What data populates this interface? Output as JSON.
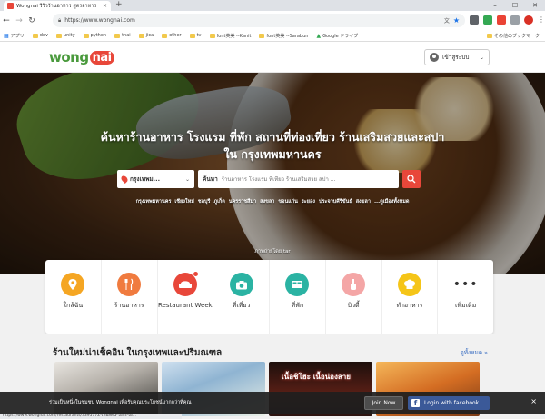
{
  "browser": {
    "tab_title": "Wongnai รีวิวร้านอาหาร สูตรอาหาร",
    "tab_close": "×",
    "new_tab": "+",
    "url": "https://www.wongnai.com",
    "bookmarks": [
      "アプリ",
      "dev",
      "unity",
      "python",
      "thai",
      "jica",
      "other",
      "tv",
      "font英美 --Kanit",
      "font英美 --Sarabun",
      "Google ドライブ"
    ],
    "bookmarks_other": "その他のブックマーク",
    "status_url": "https://www.wongnai.com/restaurants/339577Z-เฟียสติน-โอกะ-เอ..."
  },
  "header": {
    "logo_left": "wong",
    "logo_right": "nai",
    "login_label": "เข้าสู่ระบบ",
    "brand_color": "#e8473a",
    "logo_green": "#4a9a3d"
  },
  "hero": {
    "title_line1": "ค้นหาร้านอาหาร โรงแรม ที่พัก สถานที่ท่องเที่ยว ร้านเสริมสวยและสปา",
    "title_line2": "ใน กรุงเทพมหานคร",
    "location_value": "กรุงเทพม...",
    "search_keyword": "ค้นหา",
    "search_placeholder": "ร้านอาหาร โรงแรม ที่เที่ยว ร้านเสริมสวย สปา ...",
    "quick_links": [
      "กรุงเทพมหานคร",
      "เชียงใหม่",
      "ชลบุรี",
      "ภูเก็ต",
      "นครราชสีมา",
      "สงขลา",
      "ขอนแก่น",
      "ระยอง",
      "ประจวบคีรีขันธ์",
      "สงขลา",
      "...ดูเมืองทั้งหมด"
    ],
    "photo_credit": "ภาพถ่ายโดย tar"
  },
  "categories": [
    {
      "label": "ใกล้ฉัน",
      "icon": "location-pin-icon",
      "color": "#f5a623"
    },
    {
      "label": "ร้านอาหาร",
      "icon": "cutlery-icon",
      "color": "#f07b3f"
    },
    {
      "label": "Restaurant Week",
      "icon": "restaurant-week-icon",
      "color": "#e8473a"
    },
    {
      "label": "ที่เที่ยว",
      "icon": "camera-icon",
      "color": "#2bb3a3"
    },
    {
      "label": "ที่พัก",
      "icon": "bed-icon",
      "color": "#2bb3a3"
    },
    {
      "label": "บิวตี้",
      "icon": "nail-polish-icon",
      "color": "#f4a6a6"
    },
    {
      "label": "ทำอาหาร",
      "icon": "chef-hat-icon",
      "color": "#f5c518"
    },
    {
      "label": "เพิ่มเติม",
      "icon": "more-dots-icon",
      "color": "#333333"
    }
  ],
  "new_restaurants": {
    "title": "ร้านใหม่น่าเช็คอิน ในกรุงเทพและปริมณฑล",
    "see_all": "ดูทั้งหมด »",
    "promo_text": "เนื้อชิโฮะ เนื้อน่องลาย"
  },
  "banner": {
    "message": "ร่วมเป็นหนึ่งในชุมชน Wongnai เพื่อรับคุณประโยชน์มากกว่าที่คุณ",
    "join_label": "Join Now",
    "fb_label": "Login with facebook",
    "close": "×"
  }
}
